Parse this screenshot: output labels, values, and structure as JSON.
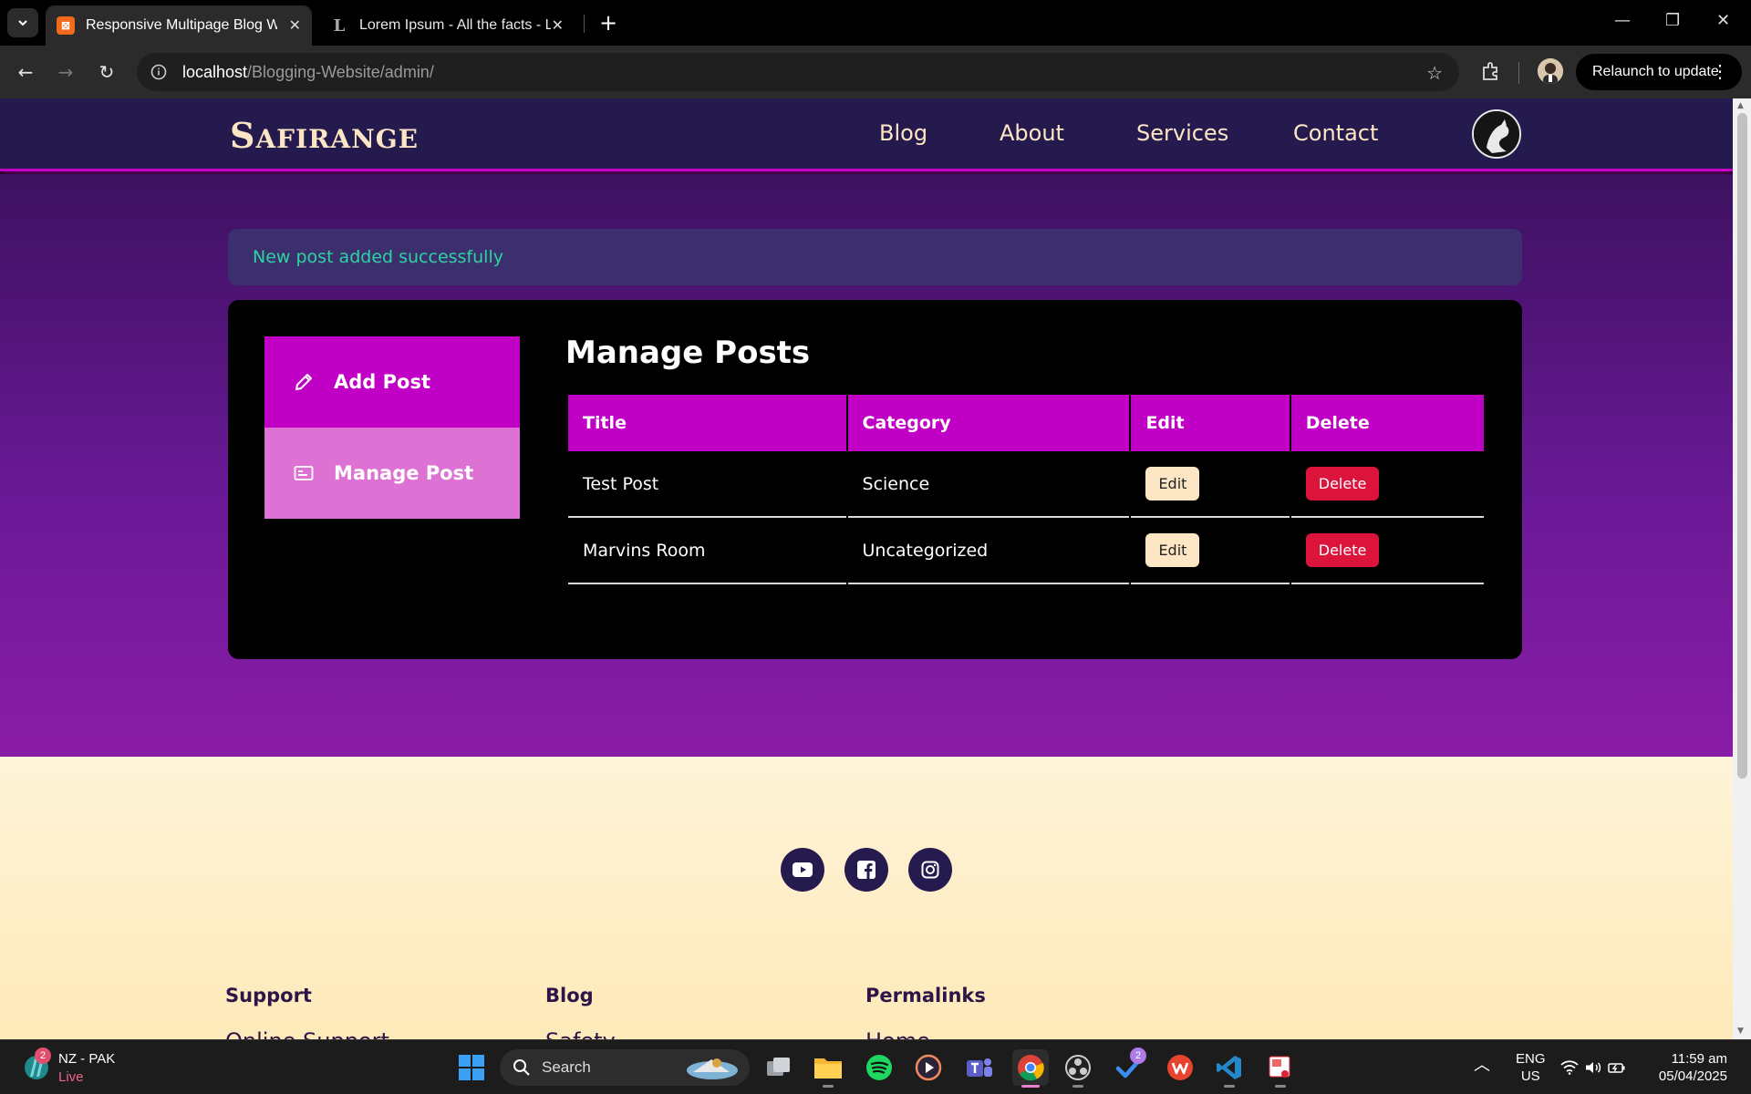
{
  "browser": {
    "tabs": [
      {
        "title": "Responsive Multipage Blog Wel",
        "active": true
      },
      {
        "title": "Lorem Ipsum - All the facts - Li",
        "active": false
      }
    ],
    "url_host": "localhost",
    "url_path": "/Blogging-Website/admin/",
    "relaunch_label": "Relaunch to update"
  },
  "site": {
    "logo_initial": "S",
    "logo_rest": "AFIRANGE",
    "nav": [
      "Blog",
      "About",
      "Services",
      "Contact"
    ]
  },
  "alert": {
    "message": "New post added successfully"
  },
  "dashboard": {
    "sidebar": [
      {
        "label": "Add Post",
        "icon": "pencil-icon"
      },
      {
        "label": "Manage Post",
        "icon": "card-icon"
      }
    ],
    "title": "Manage Posts",
    "columns": [
      "Title",
      "Category",
      "Edit",
      "Delete"
    ],
    "rows": [
      {
        "title": "Test Post",
        "category": "Science",
        "edit": "Edit",
        "delete": "Delete"
      },
      {
        "title": "Marvins Room",
        "category": "Uncategorized",
        "edit": "Edit",
        "delete": "Delete"
      }
    ]
  },
  "footer": {
    "social": [
      "youtube-icon",
      "facebook-icon",
      "instagram-icon"
    ],
    "columns": [
      {
        "title": "Support",
        "first_link": "Online Support"
      },
      {
        "title": "Blog",
        "first_link": "Safety"
      },
      {
        "title": "Permalinks",
        "first_link": "Home"
      }
    ]
  },
  "taskbar": {
    "news_badge": "2",
    "news_title": "NZ - PAK",
    "news_status": "Live",
    "search_label": "Search",
    "todo_badge": "2",
    "lang_top": "ENG",
    "lang_bottom": "US",
    "time": "11:59 am",
    "date": "05/04/2025"
  },
  "colors": {
    "accent": "#c000c4",
    "accent_light": "#de72d4",
    "nav_bg": "#241a4e",
    "cream": "#fde6c3",
    "success_text": "#2dd4a0",
    "delete_red": "#dc143c"
  }
}
